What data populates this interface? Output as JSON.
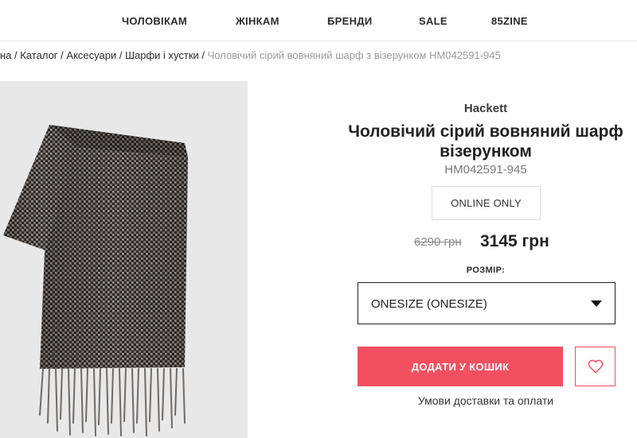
{
  "nav": {
    "items": [
      {
        "label": "ЧОЛОВІКАМ"
      },
      {
        "label": "ЖІНКАМ"
      },
      {
        "label": "БРЕНДИ"
      },
      {
        "label": "SALE"
      },
      {
        "label": "85ZINE"
      }
    ]
  },
  "breadcrumb": {
    "items": [
      "на",
      "Каталог",
      "Аксесуари",
      "Шарфи і хустки"
    ],
    "separator": "/",
    "current": "Чоловічий сірий вовняний шарф з візерунком HM042591-945"
  },
  "product": {
    "image_icon": "scarf-product-image",
    "brand": "Hackett",
    "title_line1": "Чоловічий сірий вовняний шарф",
    "title_line2": "візерунком",
    "sku": "HM042591-945",
    "badge": "ONLINE ONLY",
    "price_old": "6290 грн",
    "price_new": "3145 грн",
    "size_label": "РОЗМІР:",
    "size_value": "ONESIZE (ONESIZE)",
    "add_to_cart_label": "ДОДАТИ У КОШИК",
    "wishlist_icon": "heart-icon",
    "delivery_link": "Умови доставки та оплати"
  },
  "colors": {
    "accent": "#f25060",
    "text": "#222222",
    "muted": "#9a9a9a",
    "image_bg": "#e8e8e8"
  }
}
